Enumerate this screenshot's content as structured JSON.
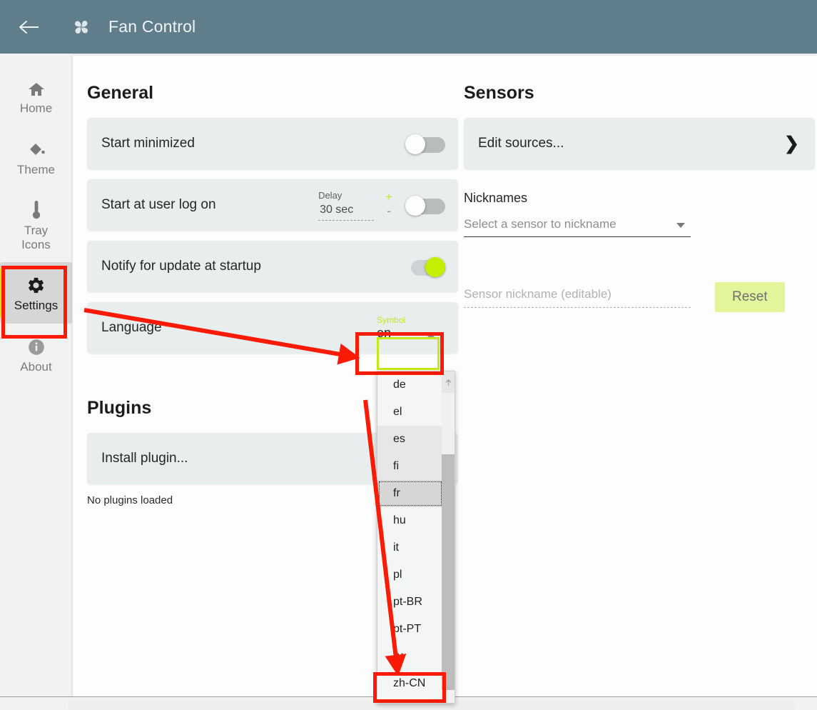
{
  "titlebar": {
    "back_icon": "back-arrow-icon",
    "app_icon": "fan-icon",
    "title": "Fan Control",
    "background": "#607d8b"
  },
  "sidebar": {
    "items": [
      {
        "label": "Home",
        "icon": "home-icon",
        "active": false
      },
      {
        "label": "Theme",
        "icon": "paint-bucket-icon",
        "active": false
      },
      {
        "label": "Tray\nIcons",
        "label_line1": "Tray",
        "label_line2": "Icons",
        "icon": "thermometer-icon",
        "active": false
      },
      {
        "label": "Settings",
        "icon": "gear-icon",
        "active": true
      },
      {
        "label": "About",
        "icon": "info-icon",
        "active": false
      }
    ],
    "active_accent": "#c6e81b",
    "active_background": "#d6d6d6"
  },
  "general": {
    "title": "General",
    "rows": [
      {
        "label": "Start minimized",
        "toggle": "off"
      },
      {
        "label": "Start at user log on",
        "toggle": "off",
        "delay_label": "Delay",
        "delay_value": "30 sec",
        "plus": "+",
        "minus": "-"
      },
      {
        "label": "Notify for update at startup",
        "toggle": "on"
      },
      {
        "label": "Language",
        "combo_label": "Symbol",
        "combo_value": "en",
        "combo_caret": "caret-up-icon"
      }
    ]
  },
  "sensors": {
    "title": "Sensors",
    "edit_sources_label": "Edit sources...",
    "edit_sources_chevron": "chevron-right-icon",
    "nicknames_label": "Nicknames",
    "select_placeholder": "Select a sensor to nickname",
    "select_caret": "caret-down-icon",
    "nickname_placeholder": "Sensor nickname (editable)",
    "reset_label": "Reset",
    "reset_background": "#e3f59a"
  },
  "plugins": {
    "title": "Plugins",
    "install_label": "Install plugin...",
    "status": "No plugins loaded"
  },
  "language_dropdown": {
    "open": true,
    "items": [
      {
        "code": "de",
        "state": "normal"
      },
      {
        "code": "el",
        "state": "normal"
      },
      {
        "code": "es",
        "state": "shade"
      },
      {
        "code": "fi",
        "state": "shade"
      },
      {
        "code": "fr",
        "state": "hover"
      },
      {
        "code": "hu",
        "state": "normal"
      },
      {
        "code": "it",
        "state": "normal"
      },
      {
        "code": "pl",
        "state": "normal"
      },
      {
        "code": "pt-BR",
        "state": "normal"
      },
      {
        "code": "pt-PT",
        "state": "normal"
      },
      {
        "code": "ru",
        "state": "normal"
      },
      {
        "code": "zh-CN",
        "state": "normal"
      }
    ],
    "scroll_up_icon": "scroll-up-arrow-icon"
  },
  "annotations": {
    "highlight_color": "#f91b06",
    "accent_color": "#c6e81b",
    "boxes": [
      {
        "name": "settings-nav-highlight"
      },
      {
        "name": "language-combo-highlight"
      },
      {
        "name": "zh-cn-option-highlight"
      }
    ],
    "arrows": [
      {
        "name": "settings-to-language-arrow"
      },
      {
        "name": "language-to-zh-cn-arrow"
      }
    ]
  }
}
